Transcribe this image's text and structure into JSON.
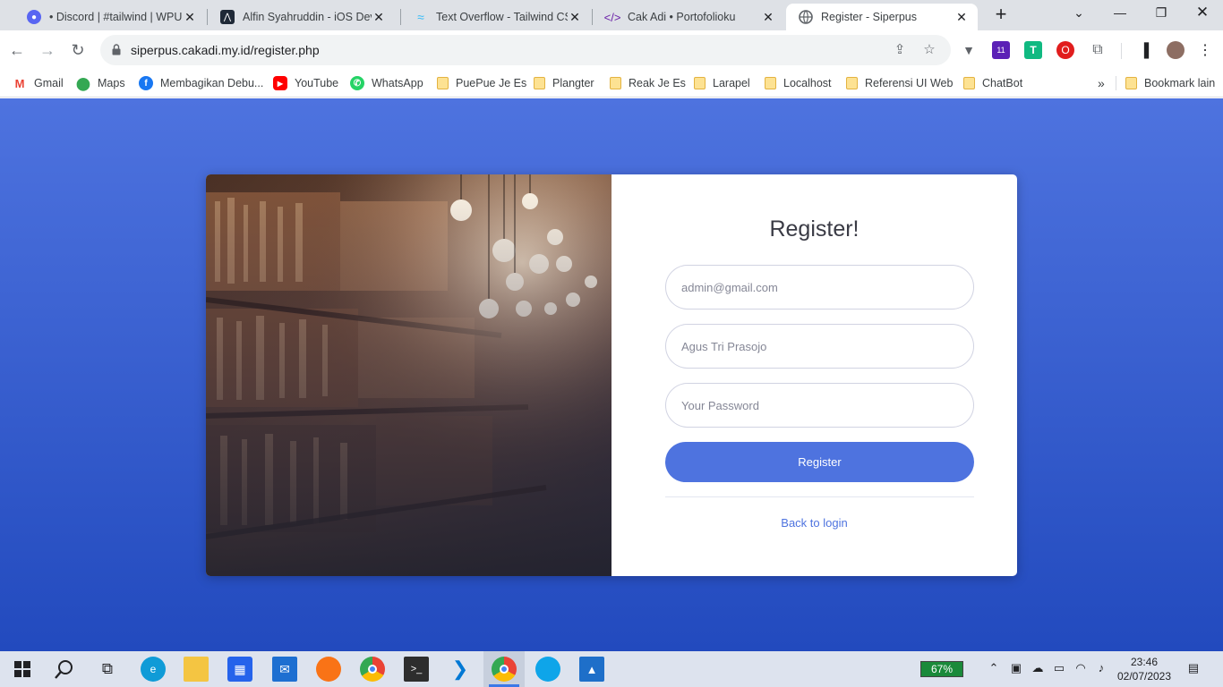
{
  "browser": {
    "tabs": [
      {
        "title": "• Discord | #tailwind | WPU",
        "icon": "discord-icon"
      },
      {
        "title": "Alfin Syahruddin - iOS Deve",
        "icon": "site-icon"
      },
      {
        "title": "Text Overflow - Tailwind CSS",
        "icon": "tailwind-icon"
      },
      {
        "title": "Cak Adi • Portofolioku",
        "icon": "portfolio-icon"
      },
      {
        "title": "Register - Siperpus",
        "icon": "globe-icon",
        "active": true
      }
    ],
    "url": "siperpus.cakadi.my.id/register.php",
    "bookmarks": [
      {
        "label": "Gmail",
        "icon": "gmail-icon"
      },
      {
        "label": "Maps",
        "icon": "maps-icon"
      },
      {
        "label": "Membagikan Debu...",
        "icon": "facebook-icon"
      },
      {
        "label": "YouTube",
        "icon": "youtube-icon"
      },
      {
        "label": "WhatsApp",
        "icon": "whatsapp-icon"
      },
      {
        "label": "PuePue Je Es",
        "icon": "folder-icon"
      },
      {
        "label": "Plangter",
        "icon": "folder-icon"
      },
      {
        "label": "Reak Je Es",
        "icon": "folder-icon"
      },
      {
        "label": "Larapel",
        "icon": "folder-icon"
      },
      {
        "label": "Localhost",
        "icon": "folder-icon"
      },
      {
        "label": "Referensi UI Web",
        "icon": "folder-icon"
      },
      {
        "label": "ChatBot",
        "icon": "folder-icon"
      }
    ],
    "more_bookmarks": "»",
    "other_bookmarks": "Bookmark lain",
    "extension_badge": "11"
  },
  "page": {
    "title": "Register!",
    "email_placeholder": "admin@gmail.com",
    "name_placeholder": "Agus Tri Prasojo",
    "password_placeholder": "Your Password",
    "register_label": "Register",
    "back_link": "Back to login",
    "colors": {
      "primary": "#4e73df",
      "background_top": "#4e73df",
      "background_bottom": "#224abe"
    }
  },
  "taskbar": {
    "battery": "67%",
    "time": "23:46",
    "date": "02/07/2023"
  }
}
